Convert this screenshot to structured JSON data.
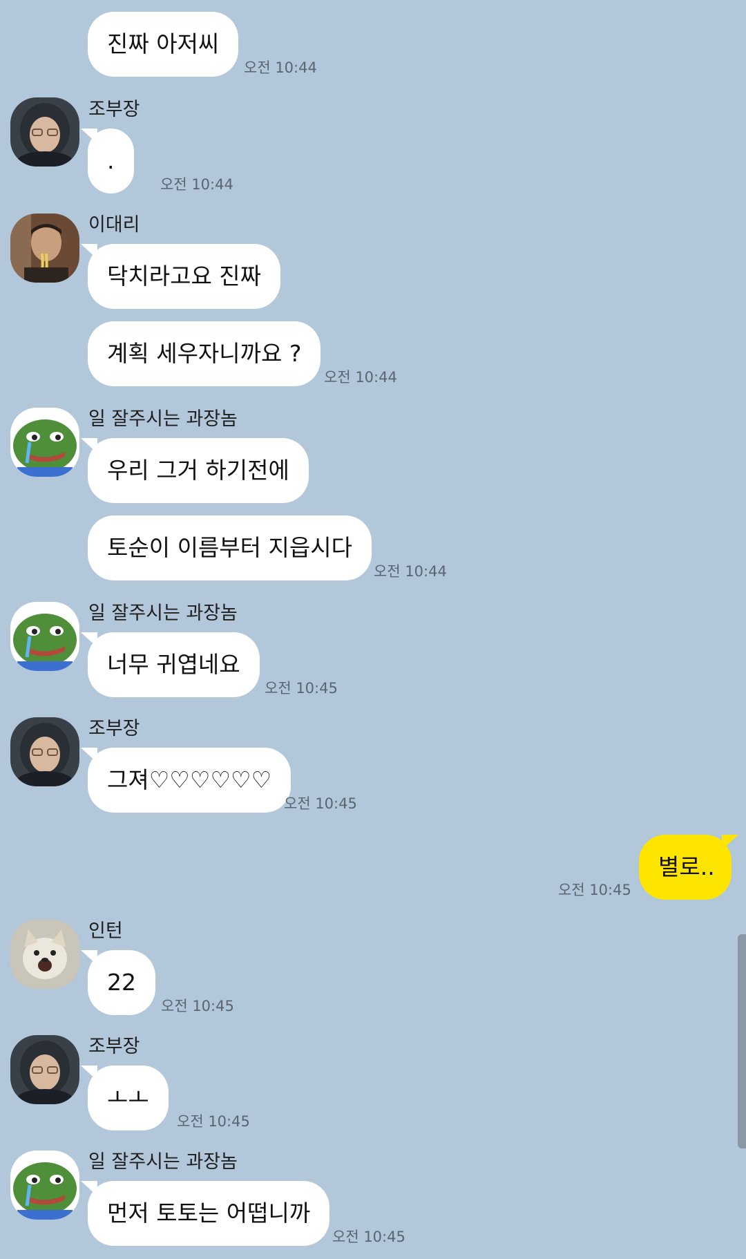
{
  "chat": {
    "messages": [
      {
        "sender": "",
        "text": "진짜 아저씨",
        "time": "오전 10:44"
      },
      {
        "sender": "조부장",
        "text": ".",
        "time": "오전 10:44"
      },
      {
        "sender": "이대리",
        "text": "닥치라고요 진짜",
        "time": ""
      },
      {
        "sender": "",
        "text": "계획 세우자니까요 ?",
        "time": "오전 10:44"
      },
      {
        "sender": "일 잘주시는 과장놈",
        "text": "우리 그거 하기전에",
        "time": ""
      },
      {
        "sender": "",
        "text": "토순이 이름부터 지읍시다",
        "time": "오전 10:44"
      },
      {
        "sender": "일 잘주시는 과장놈",
        "text": "너무 귀엽네요",
        "time": "오전 10:45"
      },
      {
        "sender": "조부장",
        "text": "그져♡♡♡♡♡♡",
        "time": "오전 10:45"
      },
      {
        "sender": "me",
        "text": "별로..",
        "time": "오전 10:45"
      },
      {
        "sender": "인턴",
        "text": "22",
        "time": "오전 10:45"
      },
      {
        "sender": "조부장",
        "text": "ㅗㅗ",
        "time": "오전 10:45"
      },
      {
        "sender": "일 잘주시는 과장놈",
        "text": "먼저 토토는 어떱니까",
        "time": "오전 10:45"
      }
    ]
  },
  "avatars": {
    "jo": "masked-man-avatar",
    "lee": "noodle-man-avatar",
    "pepe": "crying-frog-avatar",
    "intern": "dog-avatar"
  },
  "colors": {
    "background": "#b2c7da",
    "bubble_other": "#ffffff",
    "bubble_mine": "#fee500",
    "time_text": "#5a6570"
  }
}
